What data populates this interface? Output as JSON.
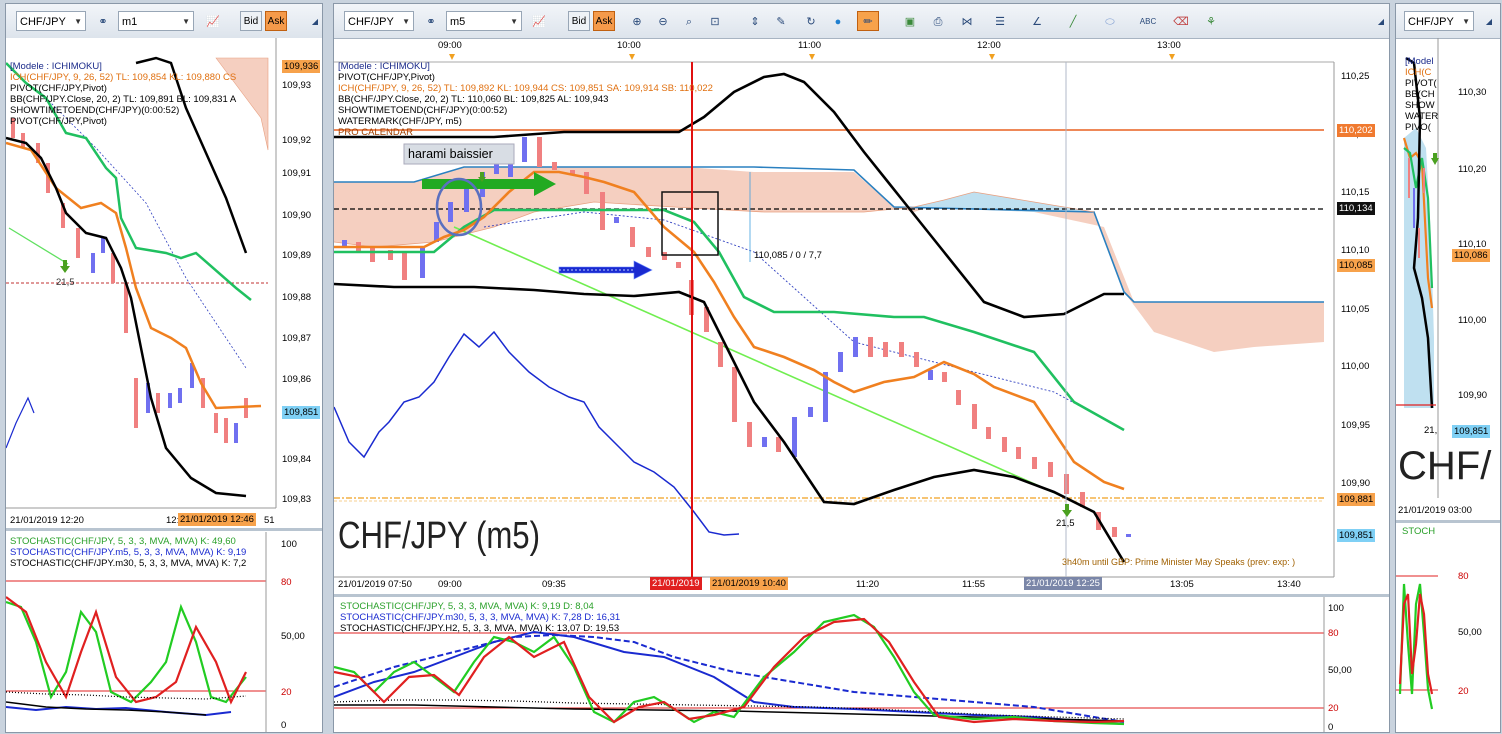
{
  "left": {
    "symbol": "CHF/JPY",
    "timeframe": "m1",
    "bid_label": "Bid",
    "ask_label": "Ask",
    "legend": [
      {
        "text": "[Modele : ICHIMOKU]",
        "color": "#1a2a8a"
      },
      {
        "text": "ICH(CHF/JPY, 9, 26, 52)  TL: 109,854  KL: 109,880  CS",
        "color": "#e07010"
      },
      {
        "text": "PIVOT(CHF/JPY,Pivot)",
        "color": "#000000"
      },
      {
        "text": "BB(CHF/JPY.Close, 20, 2)  TL: 109,891  BL: 109,831  A",
        "color": "#000000"
      },
      {
        "text": "SHOWTIMETOEND(CHF/JPY)(0:00:52)",
        "color": "#000000"
      },
      {
        "text": "PIVOT(CHF/JPY,Pivot)",
        "color": "#000000"
      }
    ],
    "price_ticks": [
      "109,93",
      "109,92",
      "109,91",
      "109,90",
      "109,89",
      "109,88",
      "109,87",
      "109,86",
      "109,85",
      "109,84",
      "109,83"
    ],
    "price_badges": {
      "top": "109,936",
      "current": "109,851"
    },
    "arrow_label": "21,5",
    "time_left": "21/01/2019 12:20",
    "time_mid": "12:4",
    "time_badge": "21/01/2019 12:46",
    "time_tail": "51",
    "stoch_legend": [
      {
        "text": "STOCHASTIC(CHF/JPY, 5, 3, 3, MVA, MVA)  K: 49,60",
        "color": "#2aa02a"
      },
      {
        "text": "STOCHASTIC(CHF/JPY.m5, 5, 3, 3, MVA, MVA)  K: 9,19",
        "color": "#1a2ad0"
      },
      {
        "text": "STOCHASTIC(CHF/JPY.m30, 5, 3, 3, MVA, MVA)  K: 7,2",
        "color": "#000000"
      }
    ],
    "stoch_ticks": [
      "100",
      "80",
      "50,00",
      "20",
      "0"
    ]
  },
  "center": {
    "symbol": "CHF/JPY",
    "timeframe": "m5",
    "bid_label": "Bid",
    "ask_label": "Ask",
    "top_times": [
      "09:00",
      "10:00",
      "11:00",
      "12:00",
      "13:00"
    ],
    "legend": [
      {
        "text": "[Modele : ICHIMOKU]",
        "color": "#1a2a8a"
      },
      {
        "text": "PIVOT(CHF/JPY,Pivot)",
        "color": "#000000"
      },
      {
        "text": "ICH(CHF/JPY, 9, 26, 52)  TL: 109,892  KL: 109,944  CS: 109,851  SA: 109,914  SB: 110,022",
        "color": "#e07010"
      },
      {
        "text": "BB(CHF/JPY.Close, 20, 2)  TL: 110,060  BL: 109,825  AL: 109,943",
        "color": "#000000"
      },
      {
        "text": "SHOWTIMETOEND(CHF/JPY)(0:00:52)",
        "color": "#000000"
      },
      {
        "text": "WATERMARK(CHF/JPY, m5)",
        "color": "#000000"
      },
      {
        "text": "PRO CALENDAR",
        "color": "#a04000"
      }
    ],
    "annotation": "harami baissier",
    "crosshair_label": "110,085 / 0 / 7,7",
    "arrow_label": "21,5",
    "watermark": "CHF/JPY (m5)",
    "calendar_event": "3h40m until GBP: Prime Minister May Speaks (prev:  exp: )",
    "price_ticks": [
      "110,25",
      "110,20",
      "110,15",
      "110,10",
      "110,05",
      "110,00",
      "109,95",
      "109,90",
      "109,85"
    ],
    "price_badges": {
      "p1": "110,202",
      "p2": "110,134",
      "p3": "110,085",
      "p4": "109,881",
      "p5": "109,851"
    },
    "bottom_times": [
      "21/01/2019 07:50",
      "09:00",
      "09:35",
      "11:20",
      "11:55",
      "13:05",
      "13:40"
    ],
    "time_badge_red": "21/01/2019",
    "time_badge_orange": "21/01/2019 10:40",
    "time_badge_gray": "21/01/2019 12:25",
    "stoch_legend": [
      {
        "text": "STOCHASTIC(CHF/JPY, 5, 3, 3, MVA, MVA)  K: 9,19  D: 8,04",
        "color": "#2aa02a"
      },
      {
        "text": "STOCHASTIC(CHF/JPY.m30, 5, 3, 3, MVA, MVA)  K: 7,28  D: 16,31",
        "color": "#1a2ad0"
      },
      {
        "text": "STOCHASTIC(CHF/JPY.H2, 5, 3, 3, MVA, MVA)  K: 13,07  D: 19,53",
        "color": "#000000"
      }
    ],
    "stoch_ticks": [
      "100",
      "80",
      "50,00",
      "20",
      "0"
    ]
  },
  "right": {
    "symbol": "CHF/JPY",
    "legend": [
      "[Model",
      "ICH(C",
      "PIVOT(",
      "BB(CH",
      "SHOW",
      "WATER",
      "PIVO("
    ],
    "price_ticks": [
      "110,30",
      "110,20",
      "110,10",
      "110,00",
      "109,90"
    ],
    "price_badges": {
      "p1": "110,086",
      "p2": "109,851"
    },
    "arrow_label": "21,",
    "watermark": "CHF/",
    "time_label": "21/01/2019 03:00",
    "stoch_label": "STOCH",
    "stoch_ticks": [
      "80",
      "50,00",
      "20"
    ]
  }
}
